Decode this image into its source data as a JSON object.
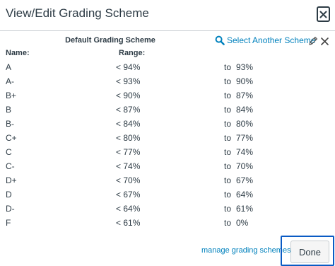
{
  "dialog": {
    "title": "View/Edit Grading Scheme",
    "close_icon": "close-icon"
  },
  "scheme": {
    "title": "Default Grading Scheme",
    "select_link": "Select Another Scheme",
    "search_icon": "search-icon",
    "edit_icon": "pencil-icon",
    "remove_icon": "close-icon"
  },
  "table": {
    "headers": {
      "name": "Name:",
      "range": "Range:"
    },
    "rows": [
      {
        "name": "A",
        "upper": "< 94%",
        "to": "to",
        "lower": "93%"
      },
      {
        "name": "A-",
        "upper": "< 93%",
        "to": "to",
        "lower": "90%"
      },
      {
        "name": "B+",
        "upper": "< 90%",
        "to": "to",
        "lower": "87%"
      },
      {
        "name": "B",
        "upper": "< 87%",
        "to": "to",
        "lower": "84%"
      },
      {
        "name": "B-",
        "upper": "< 84%",
        "to": "to",
        "lower": "80%"
      },
      {
        "name": "C+",
        "upper": "< 80%",
        "to": "to",
        "lower": "77%"
      },
      {
        "name": "C",
        "upper": "< 77%",
        "to": "to",
        "lower": "74%"
      },
      {
        "name": "C-",
        "upper": "< 74%",
        "to": "to",
        "lower": "70%"
      },
      {
        "name": "D+",
        "upper": "< 70%",
        "to": "to",
        "lower": "67%"
      },
      {
        "name": "D",
        "upper": "< 67%",
        "to": "to",
        "lower": "64%"
      },
      {
        "name": "D-",
        "upper": "< 64%",
        "to": "to",
        "lower": "61%"
      },
      {
        "name": "F",
        "upper": "< 61%",
        "to": "to",
        "lower": "0%"
      }
    ]
  },
  "footer": {
    "manage_link": "manage grading schemes",
    "done_label": "Done"
  },
  "colors": {
    "text": "#2d3b45",
    "link": "#0081bd",
    "focus_ring": "#0a5bc4"
  }
}
